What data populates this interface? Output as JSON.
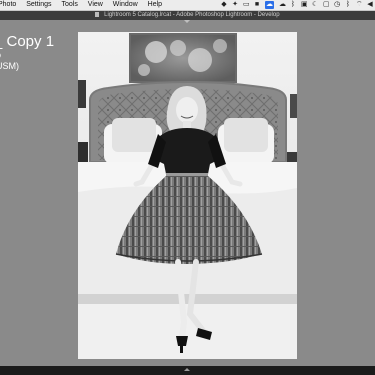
{
  "menubar": {
    "items": [
      "Photo",
      "Settings",
      "Tools",
      "View",
      "Window",
      "Help"
    ]
  },
  "window": {
    "title": "Lightroom 5 Catalog.lrcat - Adobe Photoshop Lightroom - Develop"
  },
  "overlay": {
    "title": "_ Copy 1",
    "line1": "o",
    "line2": "USM)"
  },
  "colors": {
    "workspace_bg": "#8a8a8a",
    "menubar_bg": "#ececec",
    "titlebar_bg": "#3c3c3c",
    "selected_status": "#2a6ee8"
  }
}
